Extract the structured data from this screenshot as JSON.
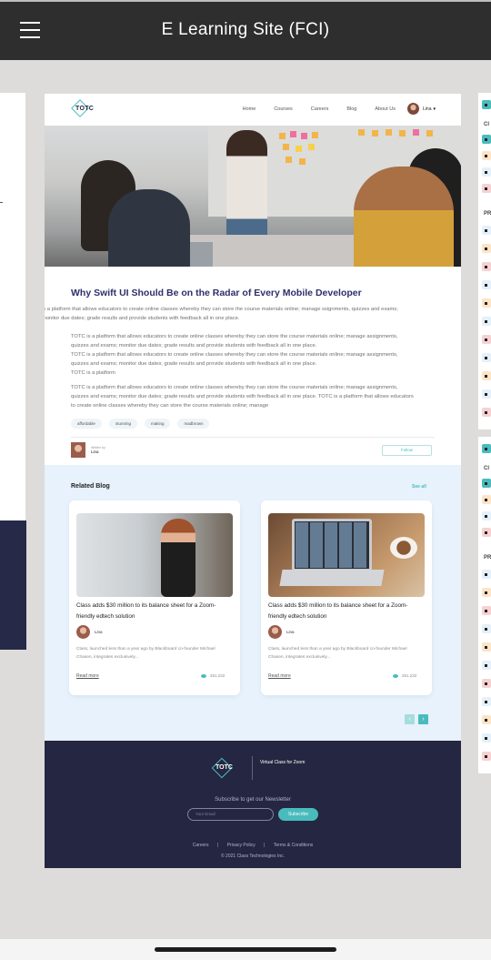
{
  "app": {
    "title": "E Learning Site (FCI)"
  },
  "nav": {
    "logo": "TOTC",
    "links": [
      "Home",
      "Courses",
      "Careers",
      "Blog",
      "About Us"
    ],
    "user": "Lina"
  },
  "article": {
    "title": "Why Swift UI Should Be on the Radar of Every Mobile Developer",
    "lead": "is a platform that allows educators to create online classes whereby they can store the course materials online; manage ssignments, quizzes and exams; monitor due dates; grade results and provide students with feedback all in one place.",
    "para1": [
      "TOTC is a platform that allows educators to create online classes whereby they can store the course materials online; manage assignments, quizzes and exams; monitor due dates; grade results and provide students with feedback all in one place.",
      "TOTC is a platform that allows educators to create online classes whereby they can store the course materials online; manage assignments, quizzes and exams; monitor due dates; grade results and provide students with feedback all in one place.",
      "TOTC is a platform"
    ],
    "para2": "TOTC is a platform that allows educators to create online classes whereby they can store the course materials online; manage assignments, quizzes and exams; monitor due dates; grade results and provide students with feedback all in one place. TOTC is a platform that allows educators to create online classes whereby they can store the course materials online; manage",
    "tags": [
      "affordable",
      "stunning",
      "making",
      "madbrown"
    ],
    "author_by": "Written by",
    "author": "Lina",
    "follow": "Follow"
  },
  "related": {
    "title": "Related Blog",
    "see_all": "See all",
    "cards": [
      {
        "title": "Class adds $30 million to its balance sheet for a Zoom-friendly edtech solution",
        "author": "Lina",
        "desc": "Class, launched less than a year ago by Blackboard co-founder Michael Chasen, integrates exclusively...",
        "read": "Read more",
        "views": "251,232"
      },
      {
        "title": "Class adds $30 million to its balance sheet for a Zoom-friendly edtech solution",
        "author": "Lina",
        "desc": "Class, launched less than a year ago by Blackboard co-founder Michael Chasen, integrates exclusively...",
        "read": "Read more",
        "views": "251,232"
      }
    ],
    "pager_prev": "‹",
    "pager_next": "›"
  },
  "footer": {
    "logo": "TOTC",
    "tagline": "Virtual Class for Zoom",
    "subscribe": "Subscribe to get our Newsletter",
    "email_placeholder": "Your Email",
    "subscribe_btn": "Subscribe",
    "links": [
      "Careers",
      "|",
      "Privacy Policy",
      "|",
      "Terms & Conditions"
    ],
    "copyright": "© 2021 Class Technologies Inc."
  },
  "side_right": {
    "top_labels": [
      "Cl",
      "PR"
    ],
    "bot_labels": [
      "Cl",
      "PR"
    ]
  },
  "colors": {
    "accent": "#49bbbd",
    "navy": "#252641",
    "title": "#2d2f6b",
    "topbar": "#2e2e2e"
  }
}
